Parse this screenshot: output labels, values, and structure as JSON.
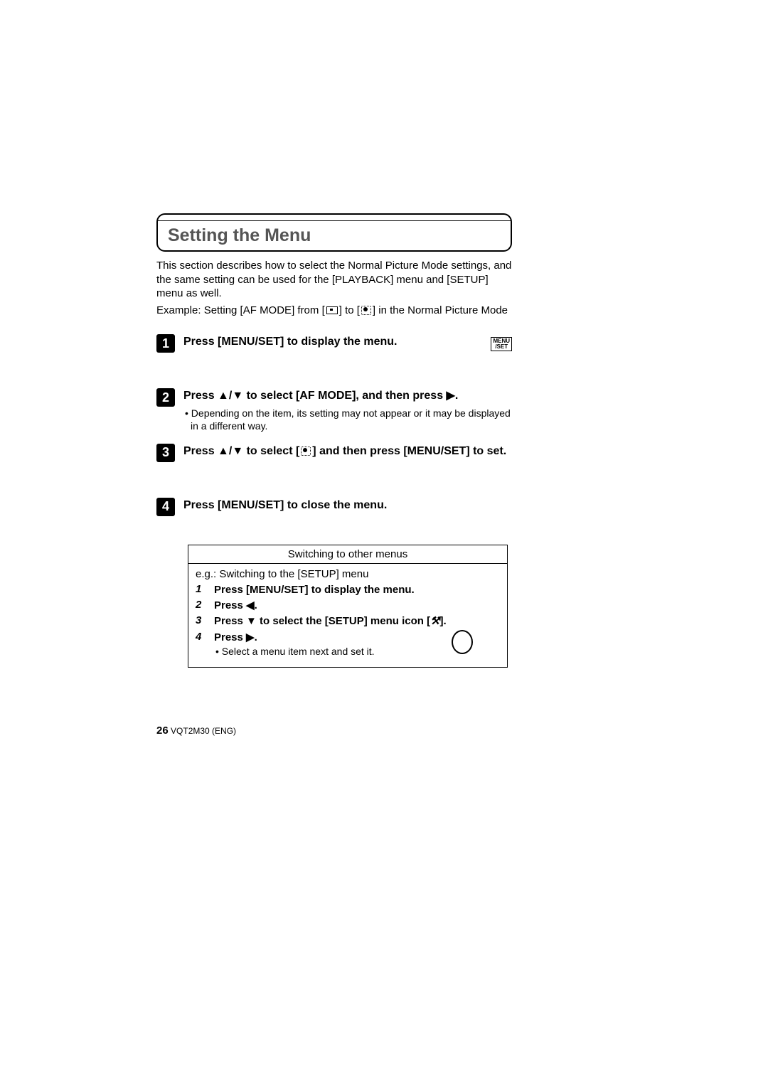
{
  "title": "Setting the Menu",
  "intro": "This section describes how to select the Normal Picture Mode settings, and the same setting can be used for the [PLAYBACK] menu and [SETUP] menu as well.",
  "example_prefix": "Example: Setting [AF MODE] from [",
  "example_mid": "] to [",
  "example_suffix": "] in the Normal Picture Mode",
  "menu_set_icon_top": "MENU",
  "menu_set_icon_bottom": "/SET",
  "steps": {
    "s1": {
      "num": "1",
      "title": "Press [MENU/SET] to display the menu."
    },
    "s2": {
      "num": "2",
      "title_a": "Press ▲/▼ to select [AF MODE], and then press ▶.",
      "bullet": "• Depending on the item, its setting may not appear or it may be displayed in a different way."
    },
    "s3": {
      "num": "3",
      "title_a": "Press ▲/▼ to select [",
      "title_b": "] and then press [MENU/SET] to set."
    },
    "s4": {
      "num": "4",
      "title": "Press [MENU/SET] to close the menu."
    }
  },
  "box": {
    "header": "Switching to other menus",
    "eg": "e.g.: Switching to the [SETUP] menu",
    "items": {
      "i1": {
        "num": "1",
        "text": "Press [MENU/SET] to display the menu."
      },
      "i2": {
        "num": "2",
        "text": "Press ◀."
      },
      "i3": {
        "num": "3",
        "text_a": "Press ▼ to select the [SETUP] menu icon [",
        "text_b": "].",
        "wrench": "⚒"
      },
      "i4": {
        "num": "4",
        "text": "Press ▶.",
        "sub": "• Select a menu item next and set it."
      }
    }
  },
  "footer": {
    "page": "26",
    "doc": " VQT2M30 (ENG)"
  }
}
